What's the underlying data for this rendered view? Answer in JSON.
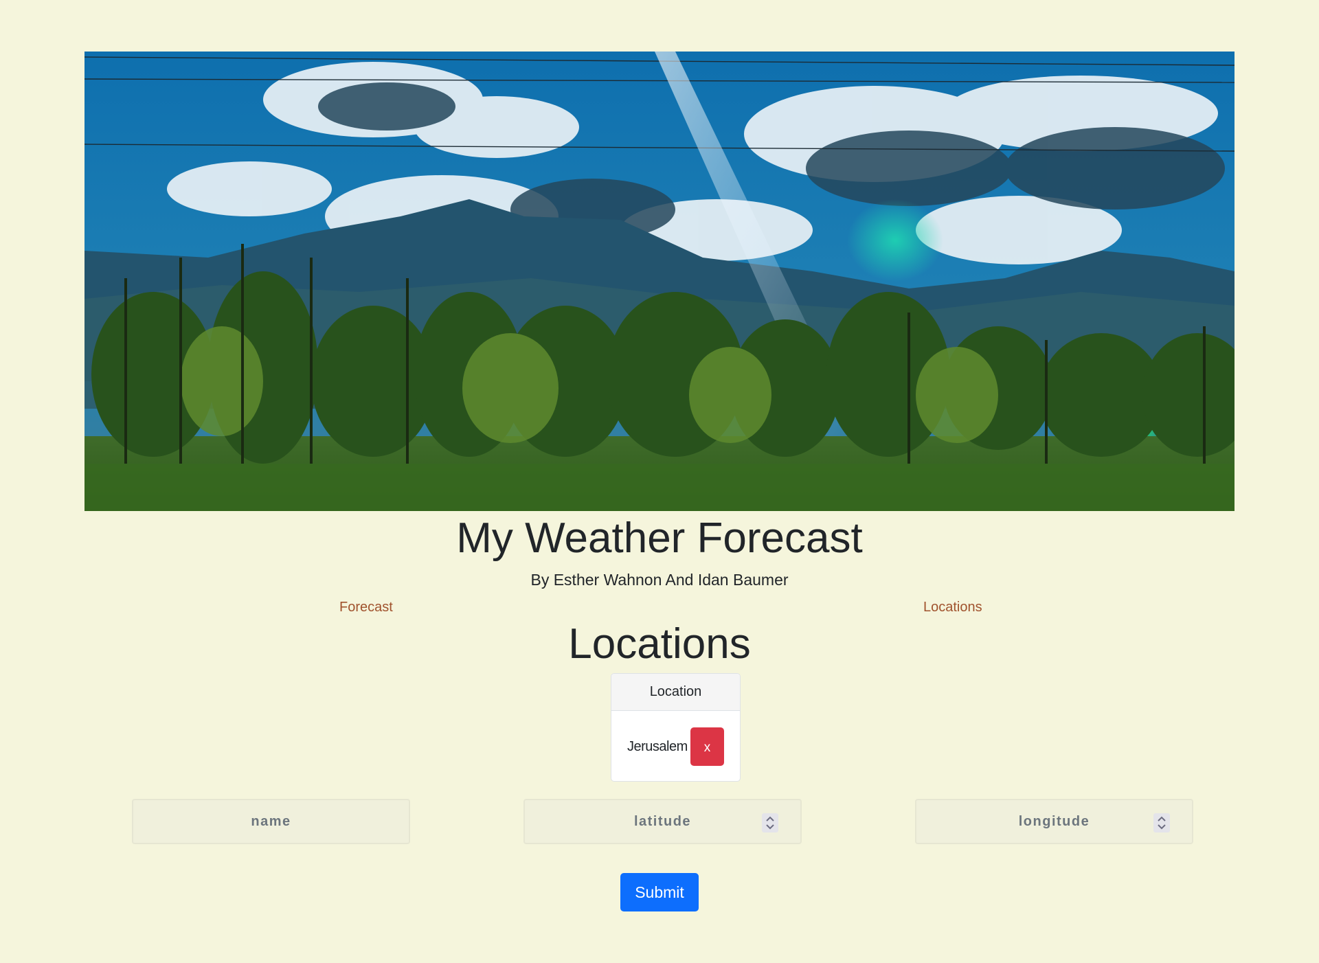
{
  "header": {
    "title": "My Weather Forecast",
    "subtitle": "By Esther Wahnon And Idan Baumer"
  },
  "nav": {
    "forecast_label": "Forecast",
    "locations_label": "Locations"
  },
  "main": {
    "heading": "Locations",
    "table": {
      "column_header": "Location",
      "rows": [
        {
          "location": "Jerusalem",
          "delete_label": "x"
        }
      ]
    },
    "form": {
      "name_placeholder": "name",
      "latitude_placeholder": "latitude",
      "longitude_placeholder": "longitude",
      "submit_label": "Submit"
    }
  },
  "colors": {
    "page_background": "#f5f5dc",
    "link": "#a0522d",
    "delete_button": "#dc3545",
    "submit_button": "#0d6efd"
  },
  "icons": {
    "spinner": "chevron-up-down-icon"
  }
}
